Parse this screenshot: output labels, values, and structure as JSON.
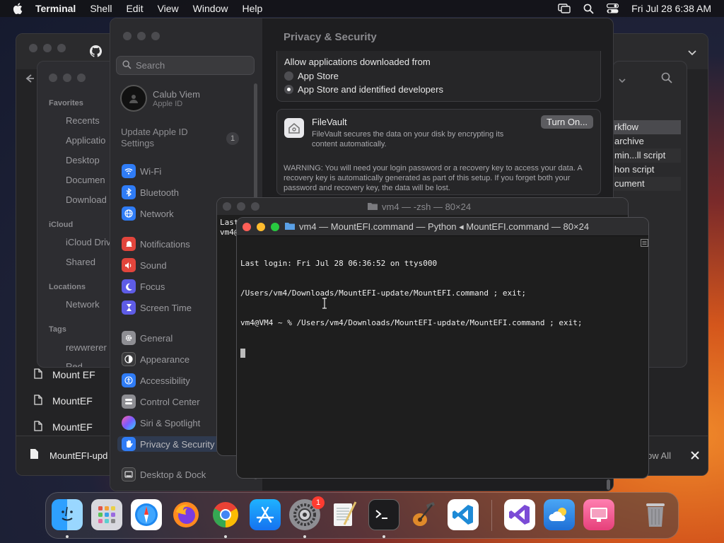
{
  "menubar": {
    "app": "Terminal",
    "items": [
      "Shell",
      "Edit",
      "View",
      "Window",
      "Help"
    ],
    "clock": "Fri Jul 28  6:38 AM"
  },
  "finder": {
    "favorites_label": "Favorites",
    "favorites": [
      "Recents",
      "Applicatio",
      "Desktop",
      "Documen",
      "Download"
    ],
    "icloud_label": "iCloud",
    "icloud": [
      "iCloud Driv",
      "Shared"
    ],
    "locations_label": "Locations",
    "locations": [
      "Network"
    ],
    "tags_label": "Tags",
    "tags": [
      "rewwrerer",
      "Red"
    ]
  },
  "browser": {
    "files": [
      "Mount EF",
      "MountEF",
      "MountEF"
    ],
    "download_name": "MountEFI-upd",
    "show_all": "ow All"
  },
  "rightwin": {
    "items": [
      "rkflow",
      "archive",
      "min...ll script",
      "hon script",
      "cument"
    ]
  },
  "settings": {
    "search_placeholder": "Search",
    "user_name": "Calub Viem",
    "user_sub": "Apple ID",
    "update_label": "Update Apple ID Settings",
    "update_badge": "1",
    "nav": [
      {
        "label": "Wi-Fi",
        "icon": "wifi-icon",
        "color": "#2f7cf6"
      },
      {
        "label": "Bluetooth",
        "icon": "bluetooth-icon",
        "color": "#2f7cf6"
      },
      {
        "label": "Network",
        "icon": "globe-icon",
        "color": "#2f7cf6"
      },
      {
        "label": "Notifications",
        "icon": "bell-icon",
        "color": "#e2453c"
      },
      {
        "label": "Sound",
        "icon": "speaker-icon",
        "color": "#e2453c"
      },
      {
        "label": "Focus",
        "icon": "moon-icon",
        "color": "#5e5ce6"
      },
      {
        "label": "Screen Time",
        "icon": "hourglass-icon",
        "color": "#5e5ce6"
      },
      {
        "label": "General",
        "icon": "gear-icon",
        "color": "#8e8e93"
      },
      {
        "label": "Appearance",
        "icon": "appearance-icon",
        "color": "#3a3a3c"
      },
      {
        "label": "Accessibility",
        "icon": "accessibility-icon",
        "color": "#2f7cf6"
      },
      {
        "label": "Control Center",
        "icon": "control-center-icon",
        "color": "#8e8e93"
      },
      {
        "label": "Siri & Spotlight",
        "icon": "siri-icon",
        "color": "#b44fd6"
      },
      {
        "label": "Privacy & Security",
        "icon": "hand-icon",
        "color": "#2f7cf6"
      },
      {
        "label": "Desktop & Dock",
        "icon": "dock-icon",
        "color": "#3a3a3c"
      }
    ],
    "page_title": "Privacy & Security",
    "allow_label": "Allow applications downloaded from",
    "opt_app_store": "App Store",
    "opt_identified": "App Store and identified developers",
    "filevault_title": "FileVault",
    "filevault_desc": "FileVault secures the data on your disk by encrypting its content automatically.",
    "filevault_button": "Turn On...",
    "warning": "WARNING: You will need your login password or a recovery key to access your data. A recovery key is automatically generated as part of this setup. If you forget both your password and recovery key, the data will be lost."
  },
  "term_back": {
    "title": "vm4 — -zsh — 80×24",
    "lines": [
      "Last",
      "vm4@"
    ]
  },
  "term_front": {
    "title": "vm4 — MountEFI.command — Python ◂ MountEFI.command — 80×24",
    "lines": [
      "Last login: Fri Jul 28 06:36:52 on ttys000",
      "/Users/vm4/Downloads/MountEFI-update/MountEFI.command ; exit;",
      "vm4@VM4 ~ % /Users/vm4/Downloads/MountEFI-update/MountEFI.command ; exit;"
    ]
  },
  "dock": {
    "settings_badge": "1"
  }
}
